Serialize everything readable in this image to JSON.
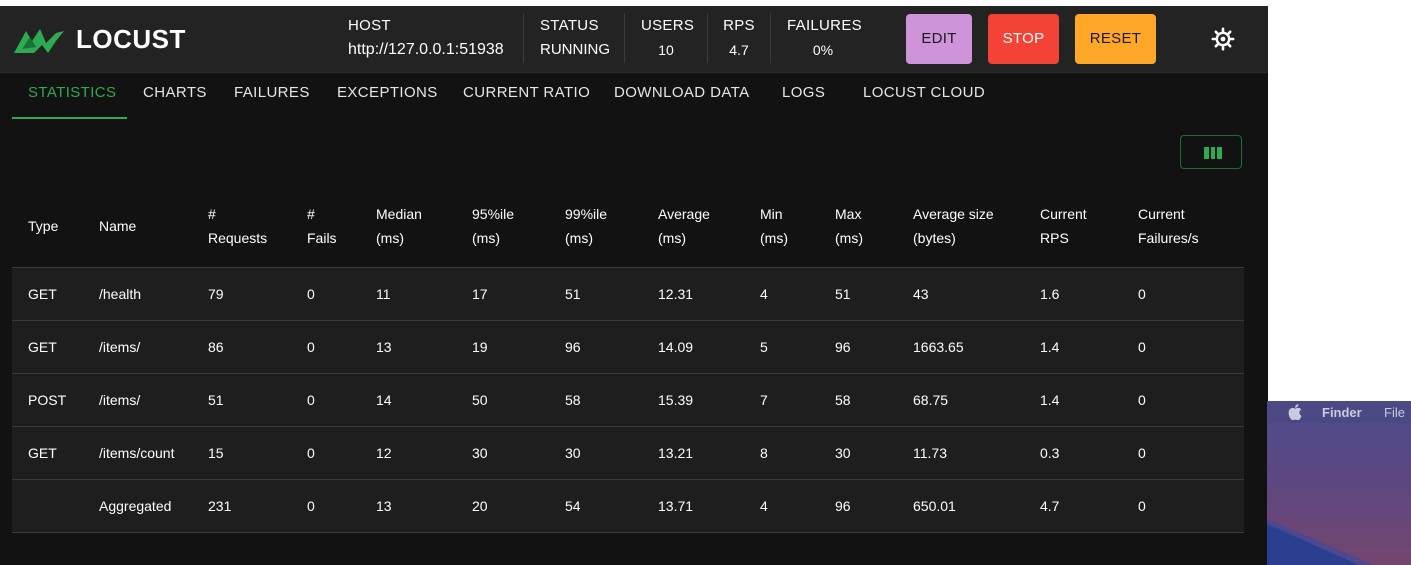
{
  "app": {
    "logo_text": "LOCUST"
  },
  "header": {
    "host": {
      "label": "HOST",
      "value": "http://127.0.0.1:51938"
    },
    "status": {
      "label": "STATUS",
      "value": "RUNNING"
    },
    "users": {
      "label": "USERS",
      "value": "10"
    },
    "rps": {
      "label": "RPS",
      "value": "4.7"
    },
    "failures": {
      "label": "FAILURES",
      "value": "0%"
    },
    "buttons": {
      "edit": "EDIT",
      "stop": "STOP",
      "reset": "RESET"
    }
  },
  "tabs": [
    {
      "label": "STATISTICS",
      "active": true
    },
    {
      "label": "CHARTS"
    },
    {
      "label": "FAILURES"
    },
    {
      "label": "EXCEPTIONS"
    },
    {
      "label": "CURRENT RATIO"
    },
    {
      "label": "DOWNLOAD DATA"
    },
    {
      "label": "LOGS"
    },
    {
      "label": "LOCUST CLOUD"
    }
  ],
  "table": {
    "headers": [
      [
        "Type"
      ],
      [
        "Name"
      ],
      [
        "#",
        "Requests"
      ],
      [
        "#",
        "Fails"
      ],
      [
        "Median",
        "(ms)"
      ],
      [
        "95%ile",
        "(ms)"
      ],
      [
        "99%ile",
        "(ms)"
      ],
      [
        "Average",
        "(ms)"
      ],
      [
        "Min",
        "(ms)"
      ],
      [
        "Max",
        "(ms)"
      ],
      [
        "Average size",
        "(bytes)"
      ],
      [
        "Current",
        "RPS"
      ],
      [
        "Current",
        "Failures/s"
      ]
    ],
    "rows": [
      [
        "GET",
        "/health",
        "79",
        "0",
        "11",
        "17",
        "51",
        "12.31",
        "4",
        "51",
        "43",
        "1.6",
        "0"
      ],
      [
        "GET",
        "/items/",
        "86",
        "0",
        "13",
        "19",
        "96",
        "14.09",
        "5",
        "96",
        "1663.65",
        "1.4",
        "0"
      ],
      [
        "POST",
        "/items/",
        "51",
        "0",
        "14",
        "50",
        "58",
        "15.39",
        "7",
        "58",
        "68.75",
        "1.4",
        "0"
      ],
      [
        "GET",
        "/items/count",
        "15",
        "0",
        "12",
        "30",
        "30",
        "13.21",
        "8",
        "30",
        "11.73",
        "0.3",
        "0"
      ],
      [
        "",
        "Aggregated",
        "231",
        "0",
        "13",
        "20",
        "54",
        "13.71",
        "4",
        "96",
        "650.01",
        "4.7",
        "0"
      ]
    ]
  },
  "colors": {
    "accent": "#2eaa52",
    "edit": "#ce93d8",
    "stop": "#f44336",
    "reset": "#ffa726"
  },
  "desktop": {
    "menu_app": "Finder",
    "menu_file": "File"
  }
}
